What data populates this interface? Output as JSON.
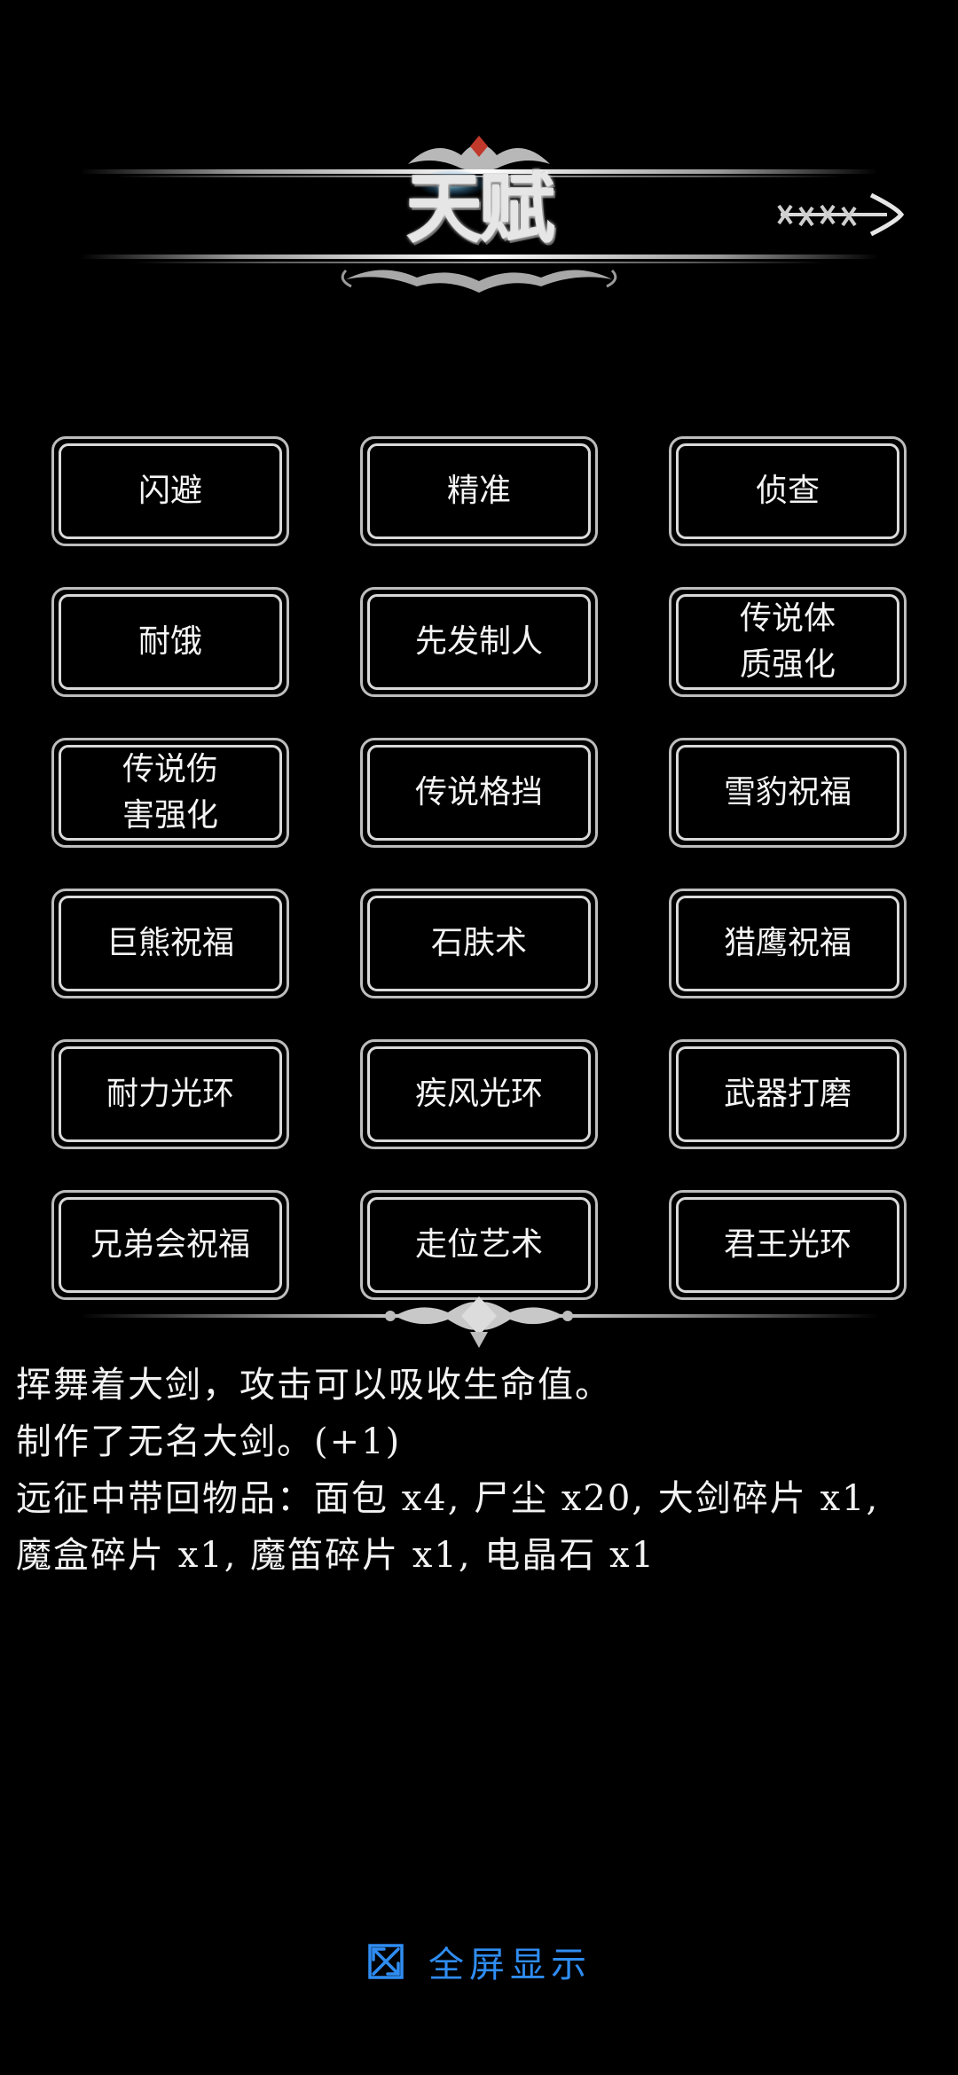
{
  "header": {
    "title": "天赋",
    "back_icon": "arrow-right-icon"
  },
  "talents": [
    {
      "label": "闪避"
    },
    {
      "label": "精准"
    },
    {
      "label": "侦查"
    },
    {
      "label": "耐饿"
    },
    {
      "label": "先发制人"
    },
    {
      "label": "传说体\n质强化"
    },
    {
      "label": "传说伤\n害强化"
    },
    {
      "label": "传说格挡"
    },
    {
      "label": "雪豹祝福"
    },
    {
      "label": "巨熊祝福"
    },
    {
      "label": "石肤术"
    },
    {
      "label": "猎鹰祝福"
    },
    {
      "label": "耐力光环"
    },
    {
      "label": "疾风光环"
    },
    {
      "label": "武器打磨"
    },
    {
      "label": "兄弟会祝福"
    },
    {
      "label": "走位艺术"
    },
    {
      "label": "君王光环"
    }
  ],
  "description": {
    "lines": [
      "挥舞着大剑，攻击可以吸收生命值。",
      "制作了无名大剑。(+1)",
      "远征中带回物品：面包 x4, 尸尘 x20, 大剑碎片 x1,",
      "魔盒碎片 x1, 魔笛碎片 x1, 电晶石 x1"
    ]
  },
  "footer": {
    "fullscreen_label": "全屏显示",
    "fullscreen_icon": "fullscreen-icon",
    "accent_color": "#2f8df2"
  }
}
